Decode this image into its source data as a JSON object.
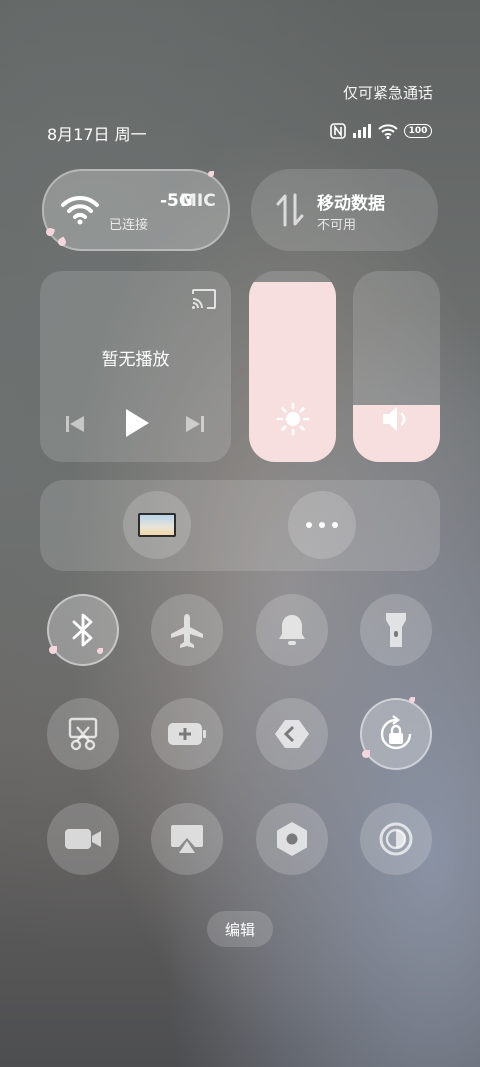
{
  "status_bar": {
    "emergency_text": "仅可紧急通话",
    "date": "8月17日 周一",
    "battery": "100",
    "icons": [
      "nfc-icon",
      "signal-icon",
      "wifi-icon",
      "battery-icon"
    ]
  },
  "wifi_tile": {
    "ssid": "-5G",
    "ssid_tail": "MIC",
    "status": "已连接"
  },
  "data_tile": {
    "title": "移动数据",
    "status": "不可用"
  },
  "media": {
    "title": "暂无播放"
  },
  "sliders": {
    "brightness_level": 0.94,
    "volume_level": 0.3
  },
  "toggles": [
    {
      "name": "bluetooth",
      "active": true
    },
    {
      "name": "airplane-mode",
      "active": false
    },
    {
      "name": "silent-mode",
      "active": false
    },
    {
      "name": "flashlight",
      "active": false
    },
    {
      "name": "screenshot",
      "active": false
    },
    {
      "name": "battery-saver",
      "active": false
    },
    {
      "name": "share",
      "active": false
    },
    {
      "name": "rotation-lock",
      "active": true
    },
    {
      "name": "screen-record",
      "active": false
    },
    {
      "name": "screen-cast",
      "active": false
    },
    {
      "name": "settings",
      "active": false
    },
    {
      "name": "dark-mode",
      "active": false
    }
  ],
  "edit_label": "编辑",
  "colors": {
    "slider_fill": "#f7dfe0",
    "accent_petal": "#f6d6dc"
  }
}
